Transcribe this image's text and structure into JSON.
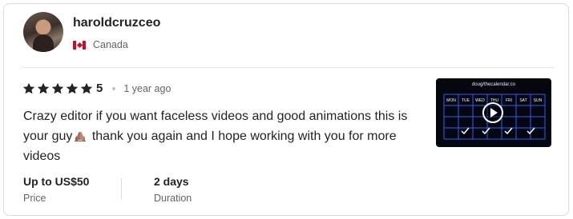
{
  "reviewer": {
    "username": "haroldcruzceo",
    "country": "Canada"
  },
  "rating": {
    "stars": 5,
    "score": "5",
    "time_ago": "1 year ago"
  },
  "review": {
    "text_before_emoji": "Crazy editor if you want faceless videos and good animations this is your guy",
    "emoji": "folded-hands-emoji",
    "text_after_emoji": " thank you again and I hope working with you for more videos"
  },
  "order": {
    "price_value": "Up to US$50",
    "price_label": "Price",
    "duration_value": "2 days",
    "duration_label": "Duration"
  },
  "video_thumbnail": {
    "title": "doug/thecalendar.co",
    "days": [
      "MON",
      "TUE",
      "WED",
      "THU",
      "FRI",
      "SAT",
      "SUN"
    ],
    "icon": "play-icon"
  },
  "colors": {
    "star": "#222325",
    "text": "#222325",
    "muted": "#62646a",
    "border": "#dadbdd",
    "thumb_grid": "#2a5cff"
  }
}
